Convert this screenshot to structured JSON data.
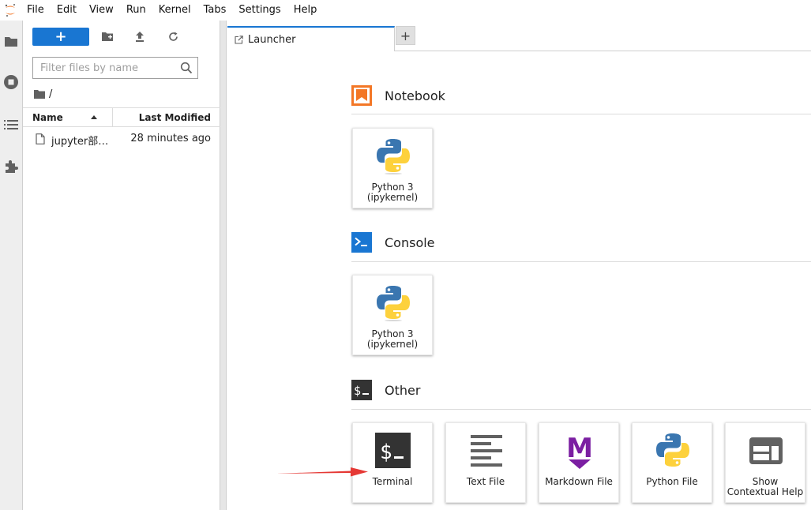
{
  "menubar": {
    "items": [
      "File",
      "Edit",
      "View",
      "Run",
      "Kernel",
      "Tabs",
      "Settings",
      "Help"
    ]
  },
  "file_browser": {
    "new_button_label": "+",
    "filter_placeholder": "Filter files by name",
    "breadcrumb": "/",
    "columns": {
      "name": "Name",
      "modified": "Last Modified"
    },
    "files": [
      {
        "name": "jupyter部署.ipynb",
        "modified": "28 minutes ago"
      }
    ]
  },
  "tabs": [
    {
      "label": "Launcher"
    }
  ],
  "tab_add_label": "+",
  "launcher": {
    "sections": [
      {
        "title": "Notebook",
        "cards": [
          {
            "label": "Python 3\n(ipykernel)"
          }
        ]
      },
      {
        "title": "Console",
        "cards": [
          {
            "label": "Python 3\n(ipykernel)"
          }
        ]
      },
      {
        "title": "Other",
        "cards": [
          {
            "label": "Terminal"
          },
          {
            "label": "Text File"
          },
          {
            "label": "Markdown File"
          },
          {
            "label": "Python File"
          },
          {
            "label": "Show\nContextual Help"
          }
        ]
      }
    ]
  },
  "colors": {
    "accent": "#1976d2",
    "notebook_icon": "#f37726",
    "console_icon": "#1976d2",
    "other_icon": "#333333",
    "markdown_icon": "#7b1fa2",
    "annotation_arrow": "#e53935"
  }
}
